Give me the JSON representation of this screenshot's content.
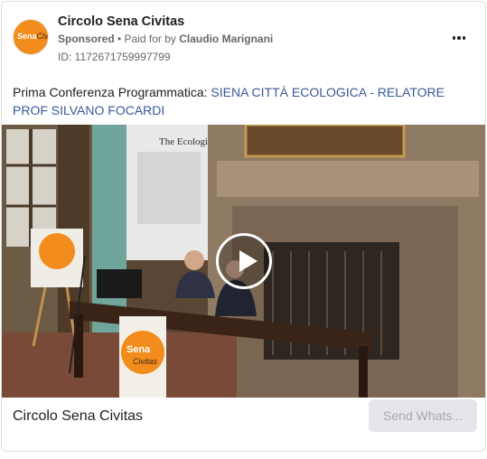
{
  "advertiser": {
    "name": "Circolo Sena Civitas",
    "logo_text": "Sena",
    "logo_text_2": "Civitas"
  },
  "meta": {
    "sponsored": "Sponsored",
    "separator": " • ",
    "paid_for_prefix": "Paid for by ",
    "payer": "Claudio Marignani",
    "ad_id": "ID: 1172671759997799"
  },
  "post": {
    "prefix": "Prima Conferenza Programmatica: ",
    "link_text": "SIENA CITTÀ ECOLOGICA - RELATORE PROF SILVANO FOCARDI"
  },
  "video": {
    "projector_text": "The Ecologist",
    "banner_text_1": "Sena",
    "banner_text_2": "Civitas"
  },
  "footer": {
    "name": "Circolo Sena Civitas",
    "cta_label": "Send Whats..."
  },
  "colors": {
    "accent_link": "#385898",
    "logo_orange": "#f28c1c",
    "cta_bg": "#e4e6eb"
  }
}
